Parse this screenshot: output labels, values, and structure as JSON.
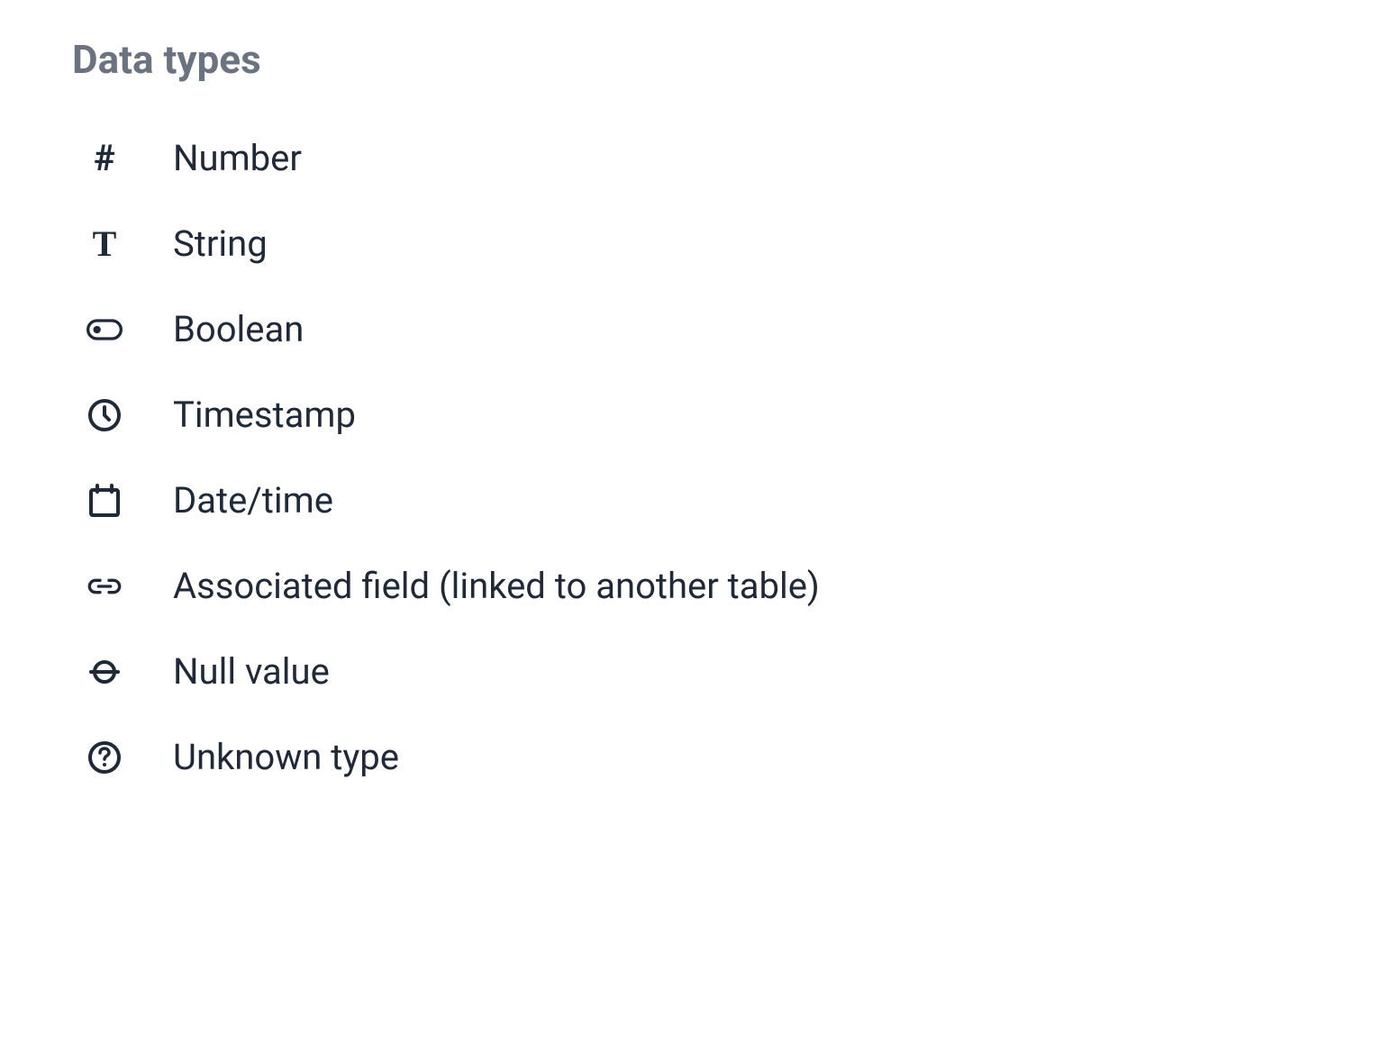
{
  "heading": "Data types",
  "items": [
    {
      "icon": "hash-icon",
      "label": "Number"
    },
    {
      "icon": "text-t-icon",
      "label": "String"
    },
    {
      "icon": "toggle-icon",
      "label": "Boolean"
    },
    {
      "icon": "clock-icon",
      "label": "Timestamp"
    },
    {
      "icon": "calendar-icon",
      "label": "Date/time"
    },
    {
      "icon": "link-icon",
      "label": "Associated field (linked to another table)"
    },
    {
      "icon": "null-icon",
      "label": "Null value"
    },
    {
      "icon": "question-circle-icon",
      "label": "Unknown type"
    }
  ]
}
